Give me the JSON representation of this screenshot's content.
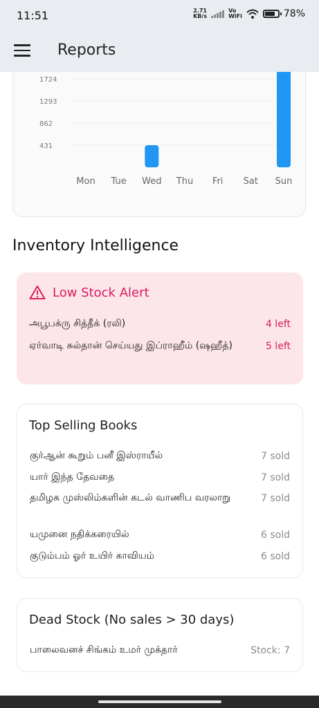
{
  "status_bar": {
    "time": "11:51",
    "net_speed_value": "2.71",
    "net_speed_unit": "KB/s",
    "vo_wifi_top": "Vo",
    "vo_wifi_bottom": "WiFi",
    "battery_percent": "78%",
    "battery_level": 0.78
  },
  "app_bar": {
    "title": "Reports",
    "menu_icon": "menu-icon"
  },
  "chart_data": {
    "type": "bar",
    "categories": [
      "Mon",
      "Tue",
      "Wed",
      "Thu",
      "Fri",
      "Sat",
      "Sun"
    ],
    "values": [
      0,
      0,
      431,
      0,
      0,
      0,
      2155
    ],
    "y_ticks": [
      "431",
      "862",
      "1293",
      "1724"
    ],
    "ylim": [
      0,
      2155
    ],
    "bar_color": "#2196f3",
    "grid": true
  },
  "inventory": {
    "section_title": "Inventory Intelligence",
    "low_stock": {
      "title": "Low Stock Alert",
      "icon": "warning-icon",
      "accent_color": "#d81b60",
      "items": [
        {
          "name": "அபூபக்ரு சித்தீக் (ரலி)",
          "qty": "4 left"
        },
        {
          "name": "ஏர்வாடி சுல்தான் செய்யது இப்ராஹீம் (ஷஹீத்)",
          "qty": "5 left"
        }
      ]
    },
    "top_selling": {
      "title": "Top Selling Books",
      "items": [
        {
          "name": "குர்ஆன் கூறும் பனீ இஸ்ராயீல்",
          "qty": "7 sold"
        },
        {
          "name": "யார் இந்த தேவதை",
          "qty": "7 sold"
        },
        {
          "name": "தமிழக முஸ்லிம்களின் கடல் வாணிப வரலாறு",
          "qty": "7 sold"
        },
        {
          "name": "யமுனை நதிக்கரையில்",
          "qty": "6 sold"
        },
        {
          "name": "குடும்பம் ஓர் உயிர் காவியம்",
          "qty": "6 sold"
        }
      ]
    },
    "dead_stock": {
      "title": "Dead Stock (No sales > 30 days)",
      "items": [
        {
          "name": "பாலைவனச் சிங்கம் உமர் முக்தார்",
          "qty": "Stock: 7"
        }
      ]
    }
  }
}
